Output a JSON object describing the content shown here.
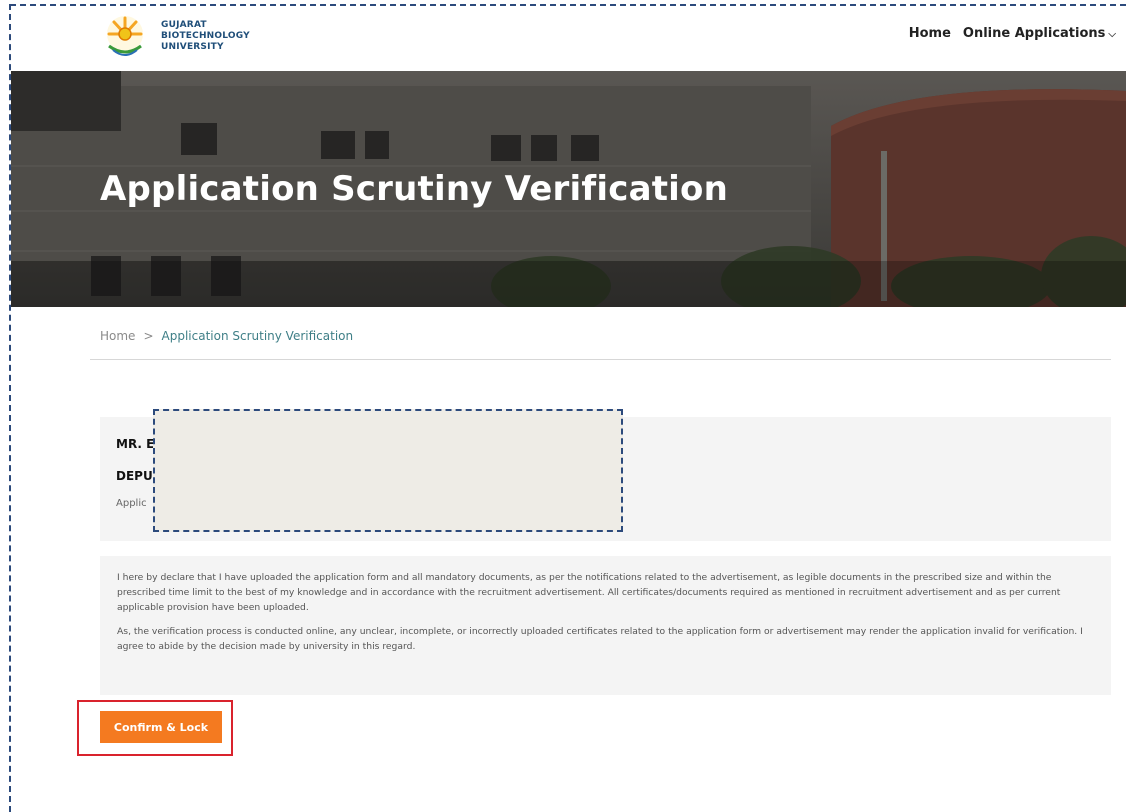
{
  "header": {
    "logo_lines": [
      "GUJARAT",
      "BIOTECHNOLOGY",
      "UNIVERSITY"
    ],
    "nav": [
      {
        "label": "Home"
      },
      {
        "label": "Online Applications"
      }
    ]
  },
  "hero": {
    "title": "Application Scrutiny Verification"
  },
  "breadcrumb": {
    "home": "Home",
    "separator": ">",
    "current": "Application Scrutiny Verification"
  },
  "applicant": {
    "name": "MR. E",
    "post": "DEPU",
    "application_no": "Applic"
  },
  "declaration": {
    "paragraphs": [
      "I here by declare that I have uploaded the application form and all mandatory documents, as per the notifications related to the advertisement, as legible documents in the prescribed size and within the prescribed time limit to the best of my knowledge and in accordance with the recruitment advertisement. All certificates/documents required as mentioned in recruitment advertisement and as per current applicable provision have been uploaded.",
      "As, the verification process is conducted online, any unclear, incomplete, or incorrectly uploaded certificates related to the application form or advertisement may render the application invalid for verification. I agree to abide by the decision made by university in this regard."
    ]
  },
  "actions": {
    "confirm_label": "Confirm & Lock"
  },
  "colors": {
    "accent": "#f47a20",
    "highlight": "#d9232d",
    "breadcrumb_active": "#3f7f87",
    "logo_text": "#1f4e79"
  }
}
